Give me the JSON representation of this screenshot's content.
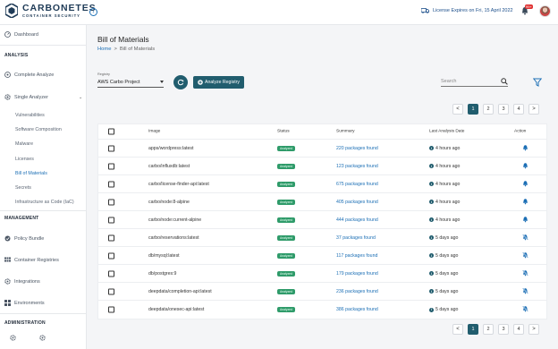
{
  "app": {
    "name": "CARBONETES",
    "subtitle": "CONTAINER SECURITY",
    "collapse_icon": "chevron-left-icon",
    "license_text": "License Expires on Fri, 15 April 2022",
    "notification_count": "99+"
  },
  "sidebar": {
    "dashboard": "Dashboard",
    "section_analysis": "ANALYSIS",
    "complete_analyze": "Complete Analyze",
    "single_analyzer": "Single Analyzer",
    "sub_items": [
      {
        "label": "Vulnerabilities"
      },
      {
        "label": "Software Composition"
      },
      {
        "label": "Malware"
      },
      {
        "label": "Licenses"
      },
      {
        "label": "Bill of Materials"
      },
      {
        "label": "Secrets"
      },
      {
        "label": "Infrastructure as Code (IaC)"
      }
    ],
    "active_sub": "Bill of Materials",
    "section_management": "MANAGEMENT",
    "policy_bundle": "Policy Bundle",
    "container_registries": "Container Registries",
    "integrations": "Integrations",
    "environments": "Environments",
    "section_administration": "ADMINISTRATION"
  },
  "page": {
    "title": "Bill of Materials",
    "breadcrumb_home": "Home",
    "breadcrumb_sep": ">",
    "breadcrumb_current": "Bill of Materials"
  },
  "toolbar": {
    "registry_label": "Registry",
    "registry_value": "AWS Carbo Project",
    "analyze_label": "Analyze Registry",
    "search_placeholder": "Search"
  },
  "pagination": {
    "pages": [
      "1",
      "2",
      "3",
      "4"
    ],
    "current": "1",
    "prev": "<",
    "next": ">"
  },
  "table": {
    "columns": [
      "Image",
      "Status",
      "Summary",
      "Last Analysis Date",
      "Action"
    ],
    "rows": [
      {
        "image": "apps/wordpress:latest",
        "status": "Analyzed",
        "summary": "220 packages found",
        "date": "4 hours ago",
        "action": "bell"
      },
      {
        "image": "carbo/influxdb:latest",
        "status": "Analyzed",
        "summary": "123 packages found",
        "date": "4 hours ago",
        "action": "bell"
      },
      {
        "image": "carbo/license-finder-api:latest",
        "status": "Analyzed",
        "summary": "675 packages found",
        "date": "4 hours ago",
        "action": "bell"
      },
      {
        "image": "carbo/node:8-alpine",
        "status": "Analyzed",
        "summary": "405 packages found",
        "date": "4 hours ago",
        "action": "bell"
      },
      {
        "image": "carbo/node:current-alpine",
        "status": "Analyzed",
        "summary": "444 packages found",
        "date": "4 hours ago",
        "action": "bell"
      },
      {
        "image": "carbo/reservations:latest",
        "status": "Analyzed",
        "summary": "37 packages found",
        "date": "5 days ago",
        "action": "bell-off"
      },
      {
        "image": "db/mysql:latest",
        "status": "Analyzed",
        "summary": "117 packages found",
        "date": "5 days ago",
        "action": "bell-off"
      },
      {
        "image": "db/postgres:9",
        "status": "Analyzed",
        "summary": "179 packages found",
        "date": "5 days ago",
        "action": "bell-off"
      },
      {
        "image": "deepdata/completion-api:latest",
        "status": "Analyzed",
        "summary": "236 packages found",
        "date": "5 days ago",
        "action": "bell-off"
      },
      {
        "image": "deepdata/onesec-api:latest",
        "status": "Analyzed",
        "summary": "386 packages found",
        "date": "5 days ago",
        "action": "bell-off"
      }
    ]
  },
  "colors": {
    "primary": "#215d6e",
    "link": "#1c6fb5",
    "analyzed_badge": "#2f9b6a"
  }
}
